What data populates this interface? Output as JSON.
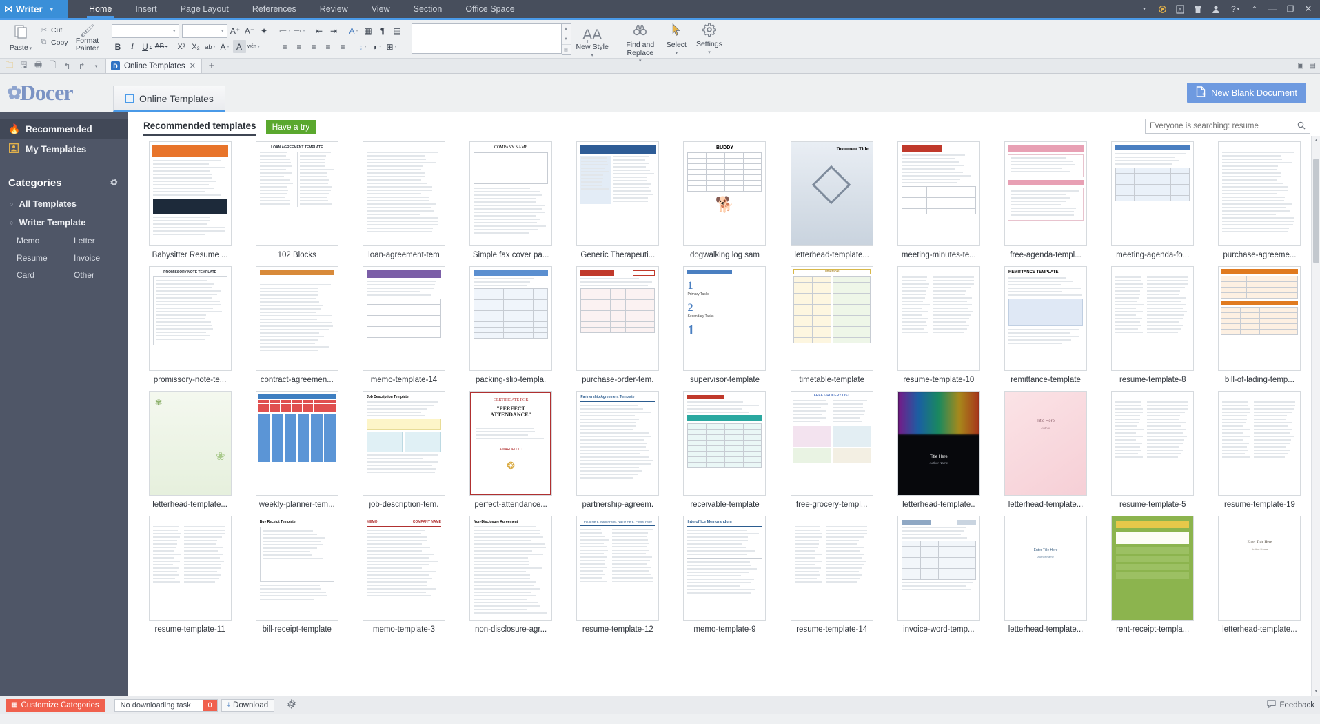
{
  "titlebar": {
    "app_name": "Writer",
    "app_caret": "▾",
    "menus": [
      {
        "label": "Home",
        "active": true
      },
      {
        "label": "Insert",
        "active": false
      },
      {
        "label": "Page Layout",
        "active": false
      },
      {
        "label": "References",
        "active": false
      },
      {
        "label": "Review",
        "active": false
      },
      {
        "label": "View",
        "active": false
      },
      {
        "label": "Section",
        "active": false
      },
      {
        "label": "Office Space",
        "active": false
      }
    ],
    "right_icons": [
      {
        "name": "overflow-caret-icon",
        "glyph": "▾"
      },
      {
        "name": "wps-cloud-icon",
        "glyph": "◑"
      },
      {
        "name": "document-a-icon",
        "glyph": "A"
      },
      {
        "name": "skin-shirt-icon",
        "glyph": "♦"
      },
      {
        "name": "user-account-icon",
        "glyph": "●"
      },
      {
        "name": "help-icon",
        "glyph": "?"
      },
      {
        "name": "collapse-ribbon-icon",
        "glyph": "^"
      },
      {
        "name": "minimize-icon",
        "glyph": "—"
      },
      {
        "name": "restore-icon",
        "glyph": "❐"
      },
      {
        "name": "close-icon",
        "glyph": "✕"
      }
    ],
    "accent_blue": "#4a9ae8",
    "bar_bg": "#474e5c"
  },
  "ribbon": {
    "paste_label": "Paste",
    "paste_caret": "▾",
    "cut_label": "Cut",
    "copy_label": "Copy",
    "format_painter_label": "Format Painter",
    "font_name_value": "",
    "font_name_placeholder": "",
    "font_size_value": "",
    "font_size_placeholder": "",
    "grow_font": "A⁺",
    "shrink_font": "A⁻",
    "clear_format": "✦",
    "bold": "B",
    "italic": "I",
    "underline": "U",
    "strikethrough": "AB",
    "superscript": "X²",
    "subscript": "X₂",
    "text_highlight": "ab",
    "font_color": "A",
    "char_shading": "A",
    "phonetic_guide": "wén",
    "bullets": "≔",
    "numbering": "≕",
    "decrease_indent": "⇤",
    "increase_indent": "⇥",
    "text_tools": "A",
    "table_grid": "▦",
    "show_marks": "¶",
    "doc_panel": "▤",
    "align_left": "≡",
    "align_center": "≡",
    "align_right": "≡",
    "justify": "≡",
    "distributed": "≡",
    "line_spacing": "↕",
    "shading_fill": "◗",
    "borders": "⊞",
    "new_style_label": "New Style",
    "new_style_caret": "▾",
    "find_replace_label": "Find and Replace",
    "find_replace_caret": "▾",
    "select_label": "Select",
    "select_caret": "▾",
    "settings_label": "Settings",
    "settings_caret": "▾"
  },
  "quick_access": {
    "icons": [
      {
        "name": "open-file-icon",
        "glyph": "🗁"
      },
      {
        "name": "save-icon",
        "glyph": "💾"
      },
      {
        "name": "print-icon",
        "glyph": "🖶"
      },
      {
        "name": "print-preview-icon",
        "glyph": "🗋"
      },
      {
        "name": "undo-icon",
        "glyph": "↩"
      },
      {
        "name": "redo-icon",
        "glyph": "↪"
      },
      {
        "name": "customize-qat-icon",
        "glyph": "▾"
      }
    ],
    "tab_title": "Online Templates",
    "tab_badge": "D",
    "tab_close": "✕",
    "new_tab": "+"
  },
  "docer": {
    "logo_text": "Docer",
    "tab_label": "Online Templates",
    "new_blank_document": "New Blank Document"
  },
  "sidebar": {
    "items": [
      {
        "label": "Recommended",
        "icon": "flame-icon",
        "active": true
      },
      {
        "label": "My Templates",
        "icon": "my-templates-icon",
        "active": false
      }
    ],
    "categories_title": "Categories",
    "categories_gear": "✷",
    "main_categories": [
      {
        "label": "All Templates"
      },
      {
        "label": "Writer Template"
      }
    ],
    "sub_categories": [
      "Memo",
      "Letter",
      "Resume",
      "Invoice",
      "Card",
      "Other"
    ]
  },
  "content": {
    "recommended_tab": "Recommended templates",
    "have_a_try": "Have a try",
    "search_placeholder": "Everyone is searching: resume",
    "search_value": "",
    "search_icon": "search-icon"
  },
  "templates": [
    {
      "label": "Babysitter Resume ...",
      "art": "resume-orange"
    },
    {
      "label": "102 Blocks",
      "art": "doc-two-col"
    },
    {
      "label": "loan-agreement-tem",
      "art": "plain-doc"
    },
    {
      "label": "Simple fax cover pa...",
      "art": "fax-cover"
    },
    {
      "label": "Generic Therapeuti...",
      "art": "blue-header-doc"
    },
    {
      "label": "dogwalking log sam",
      "art": "dog-log"
    },
    {
      "label": "letterhead-template...",
      "art": "architect"
    },
    {
      "label": "meeting-minutes-te...",
      "art": "minutes"
    },
    {
      "label": "free-agenda-templ...",
      "art": "pink-agenda"
    },
    {
      "label": "meeting-agenda-fo...",
      "art": "agenda-form"
    },
    {
      "label": "purchase-agreeme...",
      "art": "plain-doc"
    },
    {
      "label": "promissory-note-te...",
      "art": "promissory"
    },
    {
      "label": "contract-agreemen...",
      "art": "contract"
    },
    {
      "label": "memo-template-14",
      "art": "purple-memo"
    },
    {
      "label": "packing-slip-templa.",
      "art": "packing-slip"
    },
    {
      "label": "purchase-order-tem.",
      "art": "purchase-order"
    },
    {
      "label": "supervisor-template",
      "art": "supervisor"
    },
    {
      "label": "timetable-template",
      "art": "timetable"
    },
    {
      "label": "resume-template-10",
      "art": "resume-plain"
    },
    {
      "label": "remittance-template",
      "art": "remittance"
    },
    {
      "label": "resume-template-8",
      "art": "resume-plain"
    },
    {
      "label": "bill-of-lading-temp...",
      "art": "bill-lading"
    },
    {
      "label": "letterhead-template...",
      "art": "dandelion"
    },
    {
      "label": "weekly-planner-tem...",
      "art": "weekly-planner"
    },
    {
      "label": "job-description-tem.",
      "art": "job-desc"
    },
    {
      "label": "perfect-attendance...",
      "art": "certificate"
    },
    {
      "label": "partnership-agreem.",
      "art": "partnership"
    },
    {
      "label": "receivable-template",
      "art": "receivable"
    },
    {
      "label": "free-grocery-templ...",
      "art": "grocery"
    },
    {
      "label": "letterhead-template..",
      "art": "neon-black"
    },
    {
      "label": "letterhead-template...",
      "art": "pink-bokeh"
    },
    {
      "label": "resume-template-5",
      "art": "resume-plain"
    },
    {
      "label": "resume-template-19",
      "art": "resume-plain"
    },
    {
      "label": "resume-template-11",
      "art": "resume-plain"
    },
    {
      "label": "bill-receipt-template",
      "art": "bill-receipt"
    },
    {
      "label": "memo-template-3",
      "art": "memo-red"
    },
    {
      "label": "non-disclosure-agr...",
      "art": "nda"
    },
    {
      "label": "resume-template-12",
      "art": "resume-blue"
    },
    {
      "label": "memo-template-9",
      "art": "memo-blue"
    },
    {
      "label": "resume-template-14",
      "art": "resume-plain"
    },
    {
      "label": "invoice-word-temp...",
      "art": "invoice"
    },
    {
      "label": "letterhead-template...",
      "art": "winter"
    },
    {
      "label": "rent-receipt-templa...",
      "art": "green-card"
    },
    {
      "label": "letterhead-template...",
      "art": "lily"
    }
  ],
  "statusbar": {
    "customize_categories": "Customize Categories",
    "download_status": "No downloading task",
    "download_count": "0",
    "download_button": "Download",
    "settings_gear": "gear-icon",
    "feedback": "Feedback"
  },
  "colors": {
    "accent_blue": "#4a9ae8",
    "sidebar_bg": "#4f5667",
    "button_blue": "#6e9ae0",
    "green_badge": "#5aa82e",
    "orange_badge": "#f0604d",
    "title_bg": "#474e5c"
  }
}
